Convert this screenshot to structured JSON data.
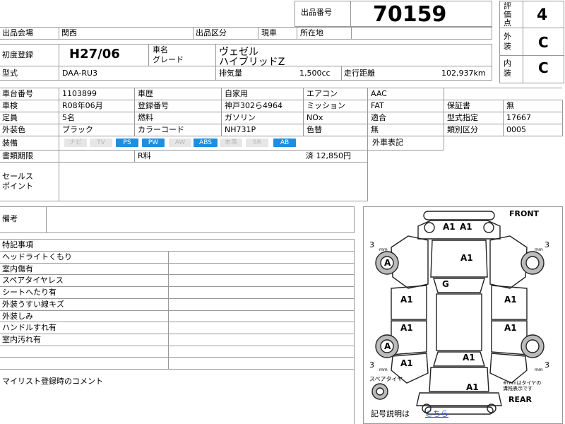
{
  "header": {
    "listing_no_label": "出品番号",
    "listing_no": "70159",
    "eval_label": "評価点",
    "eval_score": "4",
    "exterior_label": "外装",
    "exterior_grade": "C",
    "interior_label": "内装",
    "interior_grade": "C"
  },
  "row1": {
    "venue_label": "出品会場",
    "venue": "関西",
    "category_label": "出品区分",
    "category": "現車",
    "location_label": "所在地",
    "location": ""
  },
  "row2": {
    "first_reg_label": "初度登録",
    "first_reg": "H27/06",
    "name_label": "車名",
    "grade_label": "グレード",
    "car_name": "ヴェゼル",
    "grade": "ハイブリッドZ"
  },
  "row3": {
    "model_label": "型式",
    "model": "DAA-RU3",
    "displacement_label": "排気量",
    "displacement": "1,500cc",
    "mileage_label": "走行距離",
    "mileage": "102,937km"
  },
  "details": {
    "chassis_no_label": "車台番号",
    "chassis_no": "1103899",
    "history_label": "車歴",
    "history": "自家用",
    "aircon_label": "エアコン",
    "aircon": "AAC",
    "inspection_label": "車検",
    "inspection": "R08年06月",
    "reg_no_label": "登録番号",
    "reg_no": "神戸302ら4964",
    "transmission_label": "ミッション",
    "transmission": "FAT",
    "warranty_label": "保証書",
    "warranty": "無",
    "capacity_label": "定員",
    "capacity": "5名",
    "fuel_label": "燃料",
    "fuel": "ガソリン",
    "nox_label": "NOx",
    "nox": "適合",
    "type_desig_label": "型式指定",
    "type_desig": "17667",
    "color_label": "外装色",
    "color": "ブラック",
    "color_code_label": "カラーコード",
    "color_code": "NH731P",
    "repaint_label": "色替",
    "repaint": "無",
    "class_label": "類別区分",
    "class_code": "0005",
    "equipment_label": "装備",
    "equipment": [
      {
        "label": "ナビ",
        "active": false
      },
      {
        "label": "TV",
        "active": false
      },
      {
        "label": "PS",
        "active": true
      },
      {
        "label": "PW",
        "active": true
      },
      {
        "label": "AW",
        "active": false
      },
      {
        "label": "ABS",
        "active": true
      },
      {
        "label": "本革",
        "active": false
      },
      {
        "label": "SR",
        "active": false
      },
      {
        "label": "AB",
        "active": true
      }
    ],
    "exterior_notation_label": "外車表記",
    "doc_deadline_label": "書類期限",
    "recycle_label": "R料",
    "recycle_value": "済 12,850円",
    "sales_point_label": "セールス\nポイント",
    "remarks_label": "備考"
  },
  "notes": {
    "title": "特記事項",
    "items": [
      "ヘッドライトくもり",
      "室内傷有",
      "スペアタイヤレス",
      "シートへたり有",
      "外装うすい線キズ",
      "外装しみ",
      "ハンドルすれ有",
      "室内汚れ有"
    ],
    "mylist_label": "マイリスト登録時のコメント"
  },
  "diagram": {
    "front": "FRONT",
    "rear": "REAR",
    "spare_tire": "スペアタイヤ",
    "tire_note": "※mmはタイヤの\n溝残表示です",
    "legend_text": "記号説明は",
    "legend_link": "こちら",
    "marks": [
      {
        "id": "front-bumper-left",
        "text": "A1"
      },
      {
        "id": "front-bumper-right",
        "text": "A1"
      },
      {
        "id": "hood",
        "text": "A1"
      },
      {
        "id": "windshield",
        "text": "G"
      },
      {
        "id": "front-left-door",
        "text": "A1"
      },
      {
        "id": "rear-left-door",
        "text": "A1"
      },
      {
        "id": "rear-left-quarter",
        "text": "A1"
      },
      {
        "id": "front-right-door",
        "text": "A1"
      },
      {
        "id": "rear-right-door",
        "text": "A1"
      },
      {
        "id": "tailgate",
        "text": "A1"
      },
      {
        "id": "rear-bumper",
        "text": "A1"
      },
      {
        "id": "front-left-wheel",
        "text": "A"
      },
      {
        "id": "rear-left-wheel",
        "text": "A"
      }
    ],
    "tire_depths": [
      {
        "id": "front-left",
        "value": "3",
        "unit": "mm"
      },
      {
        "id": "front-right",
        "value": "3",
        "unit": "mm"
      },
      {
        "id": "rear-left",
        "value": "3",
        "unit": "mm"
      },
      {
        "id": "rear-right",
        "value": "3",
        "unit": "mm"
      }
    ]
  }
}
